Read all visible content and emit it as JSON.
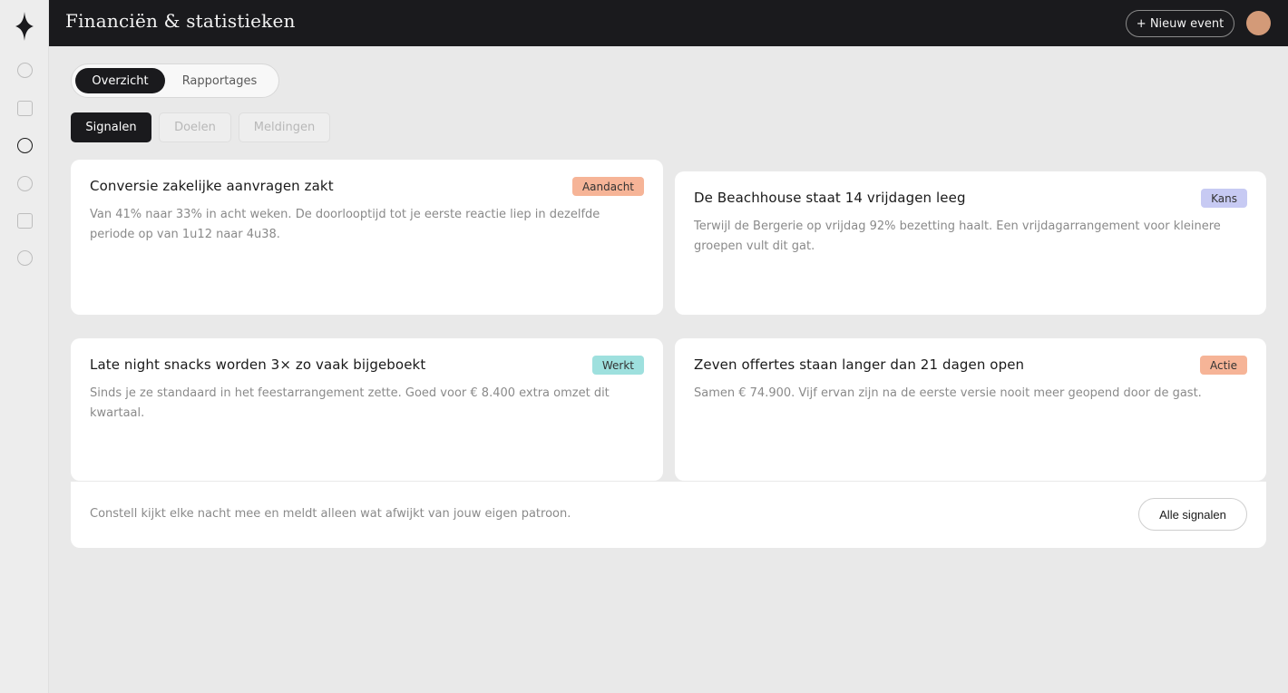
{
  "header": {
    "title": "Financiën & statistieken",
    "new_event_label": "+ Nieuw event"
  },
  "tabs": [
    {
      "label": "Overzicht",
      "active": true
    },
    {
      "label": "Rapportages",
      "active": false
    }
  ],
  "filters": [
    {
      "label": "Signalen",
      "active": true
    },
    {
      "label": "Doelen",
      "active": false
    },
    {
      "label": "Meldingen",
      "active": false
    }
  ],
  "signals": [
    {
      "title": "Conversie zakelijke aanvragen zakt",
      "body": "Van 41% naar 33% in acht weken. De doorlooptijd tot je eerste reactie liep in dezelfde periode op van 1u12 naar 4u38.",
      "badge": "Aandacht",
      "badge_color": "#f6b497"
    },
    {
      "title": "De Beachhouse staat 14 vrijdagen leeg",
      "body": "Terwijl de Bergerie op vrijdag 92% bezetting haalt. Een vrijdagarrangement voor kleinere groepen vult dit gat.",
      "badge": "Kans",
      "badge_color": "#c7caf3"
    },
    {
      "title": "Late night snacks worden 3× zo vaak bijgeboekt",
      "body": "Sinds je ze standaard in het feestarrangement zette. Goed voor € 8.400 extra omzet dit kwartaal.",
      "badge": "Werkt",
      "badge_color": "#9ee0de"
    },
    {
      "title": "Zeven offertes staan langer dan 21 dagen open",
      "body": "Samen € 74.900. Vijf ervan zijn na de eerste versie nooit meer geopend door de gast.",
      "badge": "Actie",
      "badge_color": "#f6b497"
    }
  ],
  "footer": {
    "text": "Constell kijkt elke nacht mee en meldt alleen wat afwijkt van jouw eigen patroon.",
    "button_label": "Alle signalen"
  },
  "colors": {
    "accent_dark": "#1a1a1d",
    "avatar": "#d39a78"
  }
}
